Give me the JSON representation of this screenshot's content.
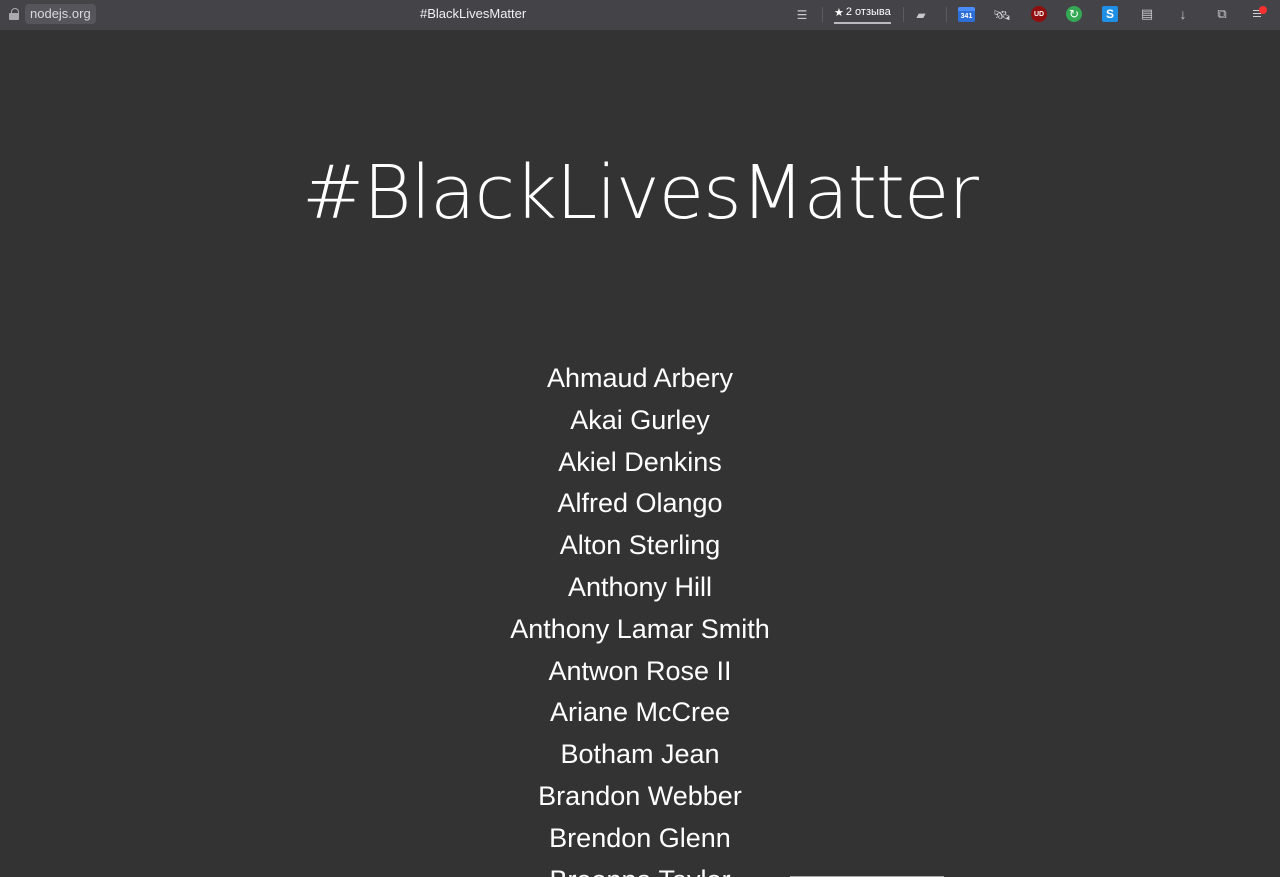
{
  "browser": {
    "domain": "nodejs.org",
    "title": "#BlackLivesMatter",
    "review_label": "2 отзыва",
    "calendar_badge": "341",
    "ublock_badge": "UD",
    "s_badge": "S",
    "icons": [
      "lock-icon",
      "reader-icon",
      "star-icon",
      "bookmark-icon",
      "calendar-icon",
      "satellite-icon",
      "ublock-icon",
      "sync-icon",
      "s-extension-icon",
      "clipboard-icon",
      "download-icon",
      "share-icon",
      "menu-icon"
    ],
    "colors": {
      "toolbar_bg": "#434348",
      "page_bg": "#333333",
      "text": "#ffffff",
      "ublock": "#8f0f0f",
      "sync": "#34a853",
      "s_extension": "#1f8fe5",
      "notification": "#ff3030"
    }
  },
  "page": {
    "title": "#BlackLivesMatter",
    "names": [
      "Ahmaud Arbery",
      "Akai Gurley",
      "Akiel Denkins",
      "Alfred Olango",
      "Alton Sterling",
      "Anthony Hill",
      "Anthony Lamar Smith",
      "Antwon Rose II",
      "Ariane McCree",
      "Botham Jean",
      "Brandon Webber",
      "Brendon Glenn",
      "Breonna Taylor"
    ]
  }
}
